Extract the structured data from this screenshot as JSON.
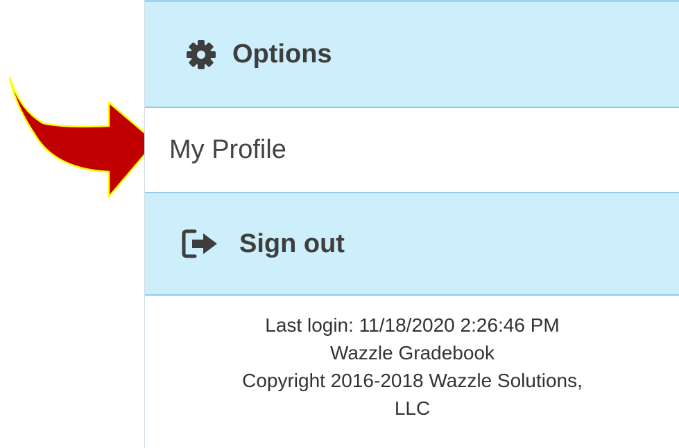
{
  "menu": {
    "options_label": "Options",
    "options_icon": "gear-icon",
    "profile_label": "My Profile",
    "signout_label": "Sign out",
    "signout_icon": "sign-out-icon"
  },
  "footer": {
    "last_login": "Last login: 11/18/2020 2:26:46 PM",
    "app_name": "Wazzle Gradebook",
    "copyright": "Copyright 2016-2018 Wazzle Solutions,",
    "copyright_cont": "LLC"
  },
  "colors": {
    "menu_row_bg": "#cdeefb",
    "menu_row_border": "#92cbe6",
    "arrow_fill": "#c00000",
    "arrow_outline": "#ffff00"
  }
}
